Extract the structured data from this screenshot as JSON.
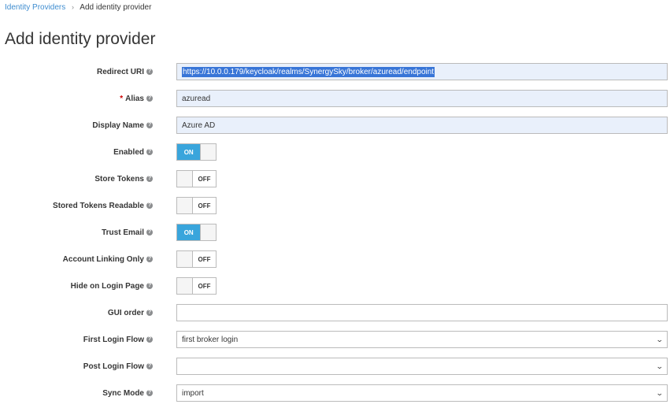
{
  "breadcrumb": {
    "parent": "Identity Providers",
    "separator": "›",
    "current": "Add identity provider"
  },
  "page_title": "Add identity provider",
  "help_glyph": "?",
  "required_mark": "*",
  "fields": {
    "redirect_uri": {
      "label": "Redirect URI",
      "value": "https://10.0.0.179/keycloak/realms/SynergySky/broker/azuread/endpoint"
    },
    "alias": {
      "label": "Alias",
      "value": "azuread"
    },
    "display_name": {
      "label": "Display Name",
      "value": "Azure AD"
    },
    "enabled": {
      "label": "Enabled",
      "state": "ON"
    },
    "store_tokens": {
      "label": "Store Tokens",
      "state": "OFF"
    },
    "stored_tokens_readable": {
      "label": "Stored Tokens Readable",
      "state": "OFF"
    },
    "trust_email": {
      "label": "Trust Email",
      "state": "ON"
    },
    "account_linking_only": {
      "label": "Account Linking Only",
      "state": "OFF"
    },
    "hide_on_login_page": {
      "label": "Hide on Login Page",
      "state": "OFF"
    },
    "gui_order": {
      "label": "GUI order",
      "value": ""
    },
    "first_login_flow": {
      "label": "First Login Flow",
      "value": "first broker login"
    },
    "post_login_flow": {
      "label": "Post Login Flow",
      "value": ""
    },
    "sync_mode": {
      "label": "Sync Mode",
      "value": "import"
    }
  },
  "icons": {
    "help": "question-circle-icon",
    "dropdown": "chevron-down-icon"
  },
  "colors": {
    "link": "#3f8dd0",
    "switch_on": "#39a5dc",
    "filled_field": "#e9f0fb",
    "text_selection": "#3875d7",
    "required": "#cc0000"
  }
}
